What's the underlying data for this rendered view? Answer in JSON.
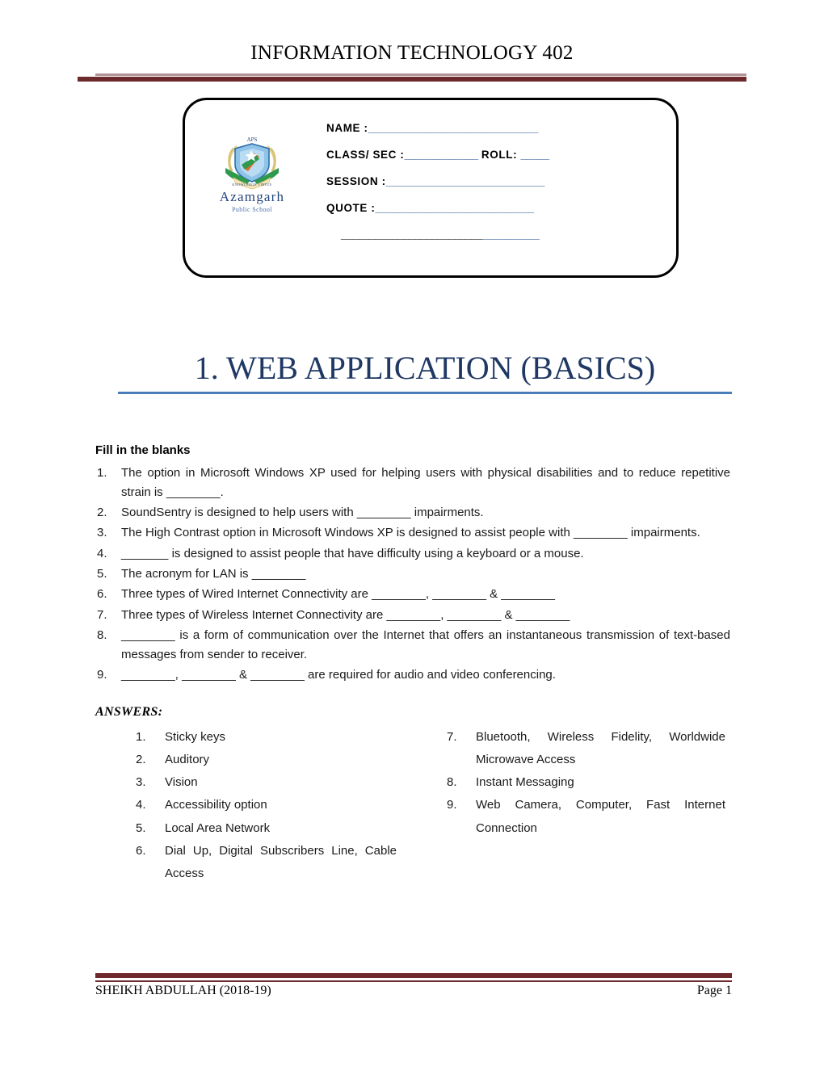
{
  "header": {
    "title": "INFORMATION TECHNOLOGY 402"
  },
  "info_box": {
    "logo": {
      "monogram": "APS",
      "name": "Azamgarh",
      "subtitle": "Public School",
      "motto": "KNOWLEDGE VIRTUE"
    },
    "fields": [
      {
        "label": "NAME :",
        "blank": "______________________________"
      },
      {
        "label": "CLASS/ SEC :",
        "blank": "_____________",
        "label2": " ROLL: ",
        "blank2": "_____"
      },
      {
        "label": "SESSION :",
        "blank": "____________________________"
      },
      {
        "label": "QUOTE :",
        "blank": "____________________________"
      },
      {
        "blank_black": "_________________________",
        "blank_blue": "__________"
      }
    ]
  },
  "chapter": {
    "title": "1.  WEB APPLICATION (BASICS)"
  },
  "body": {
    "section_heading": "Fill in the blanks",
    "questions": [
      "The option in Microsoft Windows XP used for helping users with physical disabilities and to reduce repetitive strain is ________.",
      "SoundSentry is designed to help users with ________ impairments.",
      "The High Contrast option in Microsoft Windows XP is designed to assist people with ________ impairments.",
      "_______ is designed to assist people that have difficulty using a keyboard or a mouse.",
      "The acronym for LAN is ________",
      "Three types of Wired Internet Connectivity are ________, ________ & ________",
      "Three types of Wireless Internet Connectivity are ________, ________ & ________",
      "________ is a form of communication over the Internet that offers an instantaneous transmission of text-based messages from sender to receiver.",
      "________, ________ & ________ are required for audio and video conferencing."
    ],
    "answers_heading": "ANSWERS:",
    "answers_left": [
      {
        "num": "1.",
        "text": "Sticky keys"
      },
      {
        "num": "2.",
        "text": "Auditory"
      },
      {
        "num": "3.",
        "text": "Vision"
      },
      {
        "num": "4.",
        "text": "Accessibility option"
      },
      {
        "num": "5.",
        "text": "Local Area Network"
      },
      {
        "num": "6.",
        "text": "Dial Up, Digital Subscribers Line, Cable Access"
      }
    ],
    "answers_right": [
      {
        "num": "7.",
        "text": "Bluetooth, Wireless Fidelity, Worldwide Microwave Access"
      },
      {
        "num": "8.",
        "text": "Instant Messaging"
      },
      {
        "num": "9.",
        "text": "Web Camera, Computer, Fast Internet Connection"
      }
    ]
  },
  "footer": {
    "author": "SHEIKH ABDULLAH (2018-19)",
    "page": "Page 1"
  },
  "colors": {
    "rule_maroon": "#6d2a2c",
    "rule_mauve": "#b09495",
    "title_navy": "#1f3864",
    "title_rule_blue": "#4a7ebb",
    "blank_blue": "#2b5597"
  }
}
